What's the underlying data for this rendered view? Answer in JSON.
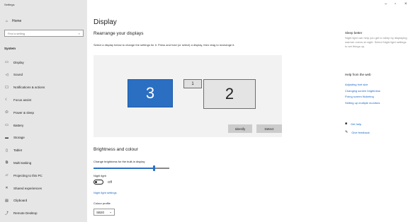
{
  "window": {
    "title": "Settings",
    "minimize": "–",
    "maximize": "▫",
    "close": "×"
  },
  "sidebar": {
    "home_label": "Home",
    "search_placeholder": "Find a setting",
    "section": "System",
    "items": [
      {
        "label": "Display",
        "icon": "monitor-icon",
        "glyph": "▭"
      },
      {
        "label": "Sound",
        "icon": "speaker-icon",
        "glyph": "◁"
      },
      {
        "label": "Notifications & actions",
        "icon": "notification-icon",
        "glyph": "☐"
      },
      {
        "label": "Focus assist",
        "icon": "moon-icon",
        "glyph": "☾"
      },
      {
        "label": "Power & sleep",
        "icon": "power-icon",
        "glyph": "⏻"
      },
      {
        "label": "Battery",
        "icon": "battery-icon",
        "glyph": "▭"
      },
      {
        "label": "Storage",
        "icon": "storage-icon",
        "glyph": "▬"
      },
      {
        "label": "Tablet",
        "icon": "tablet-icon",
        "glyph": "▯"
      },
      {
        "label": "Multi-tasking",
        "icon": "multitask-icon",
        "glyph": "⧉"
      },
      {
        "label": "Projecting to this PC",
        "icon": "projector-icon",
        "glyph": "▱"
      },
      {
        "label": "Shared experiences",
        "icon": "shared-icon",
        "glyph": "✕"
      },
      {
        "label": "Clipboard",
        "icon": "clipboard-icon",
        "glyph": "▤"
      },
      {
        "label": "Remote Desktop",
        "icon": "remote-icon",
        "glyph": "⤴"
      }
    ]
  },
  "main": {
    "title": "Display",
    "subtitle": "Rearrange your displays",
    "instruction": "Select a display below to change the settings for it. Press and hold (or select) a display, then drag to rearrange it.",
    "monitors": {
      "m3": "3",
      "m1": "1",
      "m2": "2"
    },
    "identify_label": "Identify",
    "detect_label": "Detect",
    "brightness_heading": "Brightness and colour",
    "brightness_label": "Change brightness for the built-in display",
    "brightness_value": 0.8,
    "night_light_label": "Night light",
    "night_light_state": "Off",
    "night_light_settings": "Night light settings",
    "colour_profile_label": "Colour profile",
    "colour_profile_value": "SB20"
  },
  "right": {
    "sleep_heading": "Sleep better",
    "sleep_text": "Night light can help you get to sleep by displaying warmer colors at night. Select Night light settings to set things up.",
    "help_heading": "Help from the web",
    "help_links": [
      "Adjusting font size",
      "Changing screen brightness",
      "Fixing screen flickering",
      "Setting up multiple monitors"
    ],
    "get_help": "Get help",
    "give_feedback": "Give feedback"
  },
  "colors": {
    "accent": "#2b6fc2",
    "sidebar_bg": "#e6e6e6",
    "link": "#1a68c4"
  }
}
